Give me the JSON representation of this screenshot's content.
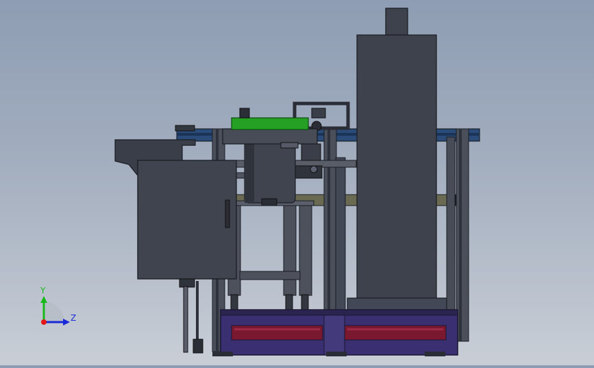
{
  "triad": {
    "y_label": "Y",
    "z_label": "Z",
    "y_color": "#18b818",
    "z_color": "#1a2ad8",
    "origin_color": "#e01818"
  },
  "colors": {
    "background_top": "#8e9db3",
    "background_bottom": "#c9ced6",
    "steel_dark": "#3d424d",
    "frame_edge": "#1a1c22",
    "base_purple": "#3a2f70",
    "drawer_red": "#7a1830",
    "bowl_green": "#25a025",
    "rail_blue": "#2a4a78",
    "beam_olive": "#6a6a52"
  }
}
